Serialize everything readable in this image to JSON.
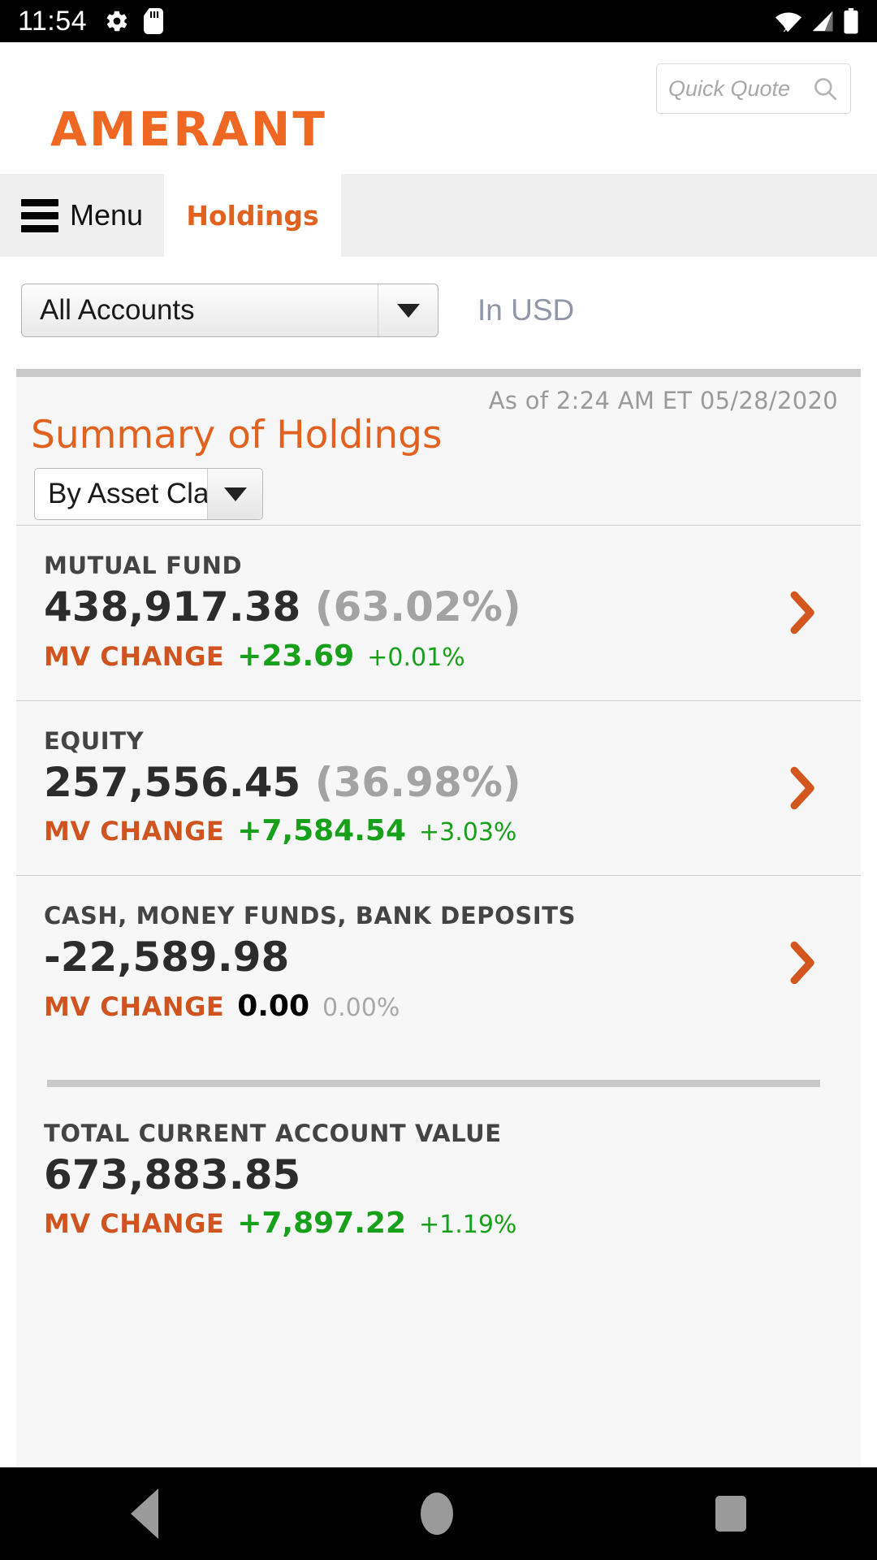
{
  "status_bar": {
    "time": "11:54",
    "left_icons": [
      "gear-icon",
      "sd-card-icon"
    ],
    "right_icons": [
      "wifi-off-icon",
      "cell-signal-icon",
      "battery-icon"
    ]
  },
  "header": {
    "brand": "AMERANT",
    "brand_color": "#ee6723",
    "quick_quote_placeholder": "Quick Quote",
    "quick_quote_value": ""
  },
  "tabbar": {
    "menu_label": "Menu",
    "active_tab": "Holdings"
  },
  "account_bar": {
    "account_selected": "All Accounts",
    "currency_label": "In USD"
  },
  "summary": {
    "title": "Summary of Holdings",
    "as_of": "As of  2:24 AM ET 05/28/2020",
    "group_by_selected": "By Asset Class",
    "rows": [
      {
        "label": "MUTUAL FUND",
        "value": "438,917.38",
        "percent_of_total": "(63.02%)",
        "mv_change_label": "MV CHANGE",
        "mv_change_amount": "+23.69",
        "mv_change_percent": "+0.01%",
        "change_direction": "up",
        "has_chevron": true
      },
      {
        "label": "EQUITY",
        "value": "257,556.45",
        "percent_of_total": "(36.98%)",
        "mv_change_label": "MV CHANGE",
        "mv_change_amount": "+7,584.54",
        "mv_change_percent": "+3.03%",
        "change_direction": "up",
        "has_chevron": true
      },
      {
        "label": "CASH, MONEY FUNDS, BANK DEPOSITS",
        "value": "-22,589.98",
        "percent_of_total": "",
        "mv_change_label": "MV CHANGE",
        "mv_change_amount": "0.00",
        "mv_change_percent": "0.00%",
        "change_direction": "flat",
        "has_chevron": true
      }
    ],
    "total": {
      "label": "TOTAL CURRENT ACCOUNT VALUE",
      "value": "673,883.85",
      "percent_of_total": "",
      "mv_change_label": "MV CHANGE",
      "mv_change_amount": "+7,897.22",
      "mv_change_percent": "+1.19%",
      "change_direction": "up"
    }
  },
  "colors": {
    "brand_orange": "#e1611e",
    "logo_orange": "#ee6723",
    "positive_green": "#17a01a",
    "mv_label_orange": "#cf5420",
    "muted_gray": "#a3a3a3"
  },
  "nav_bar": {
    "back": "back-icon",
    "home": "home-icon",
    "recents": "recents-icon"
  }
}
